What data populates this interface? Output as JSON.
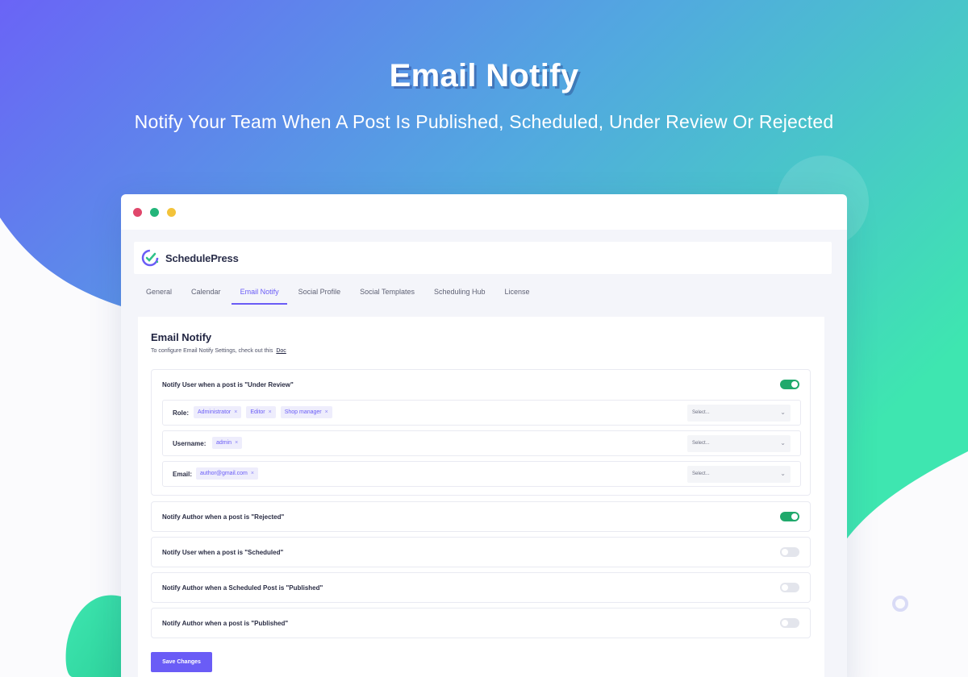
{
  "hero": {
    "title": "Email Notify",
    "subtitle": "Notify Your Team When A Post Is Published, Scheduled, Under Review Or Rejected"
  },
  "colors": {
    "gradient_start": "#6a64f6",
    "gradient_end": "#3ee6b0",
    "accent": "#6a5cf6",
    "toggle_on": "#20a96c",
    "toggle_off": "#e3e5ec",
    "dot_red": "#e0476b",
    "dot_green": "#23b57a",
    "dot_yellow": "#f3c33a"
  },
  "app": {
    "name": "SchedulePress",
    "logo_icon": "schedulepress-clock-check-icon"
  },
  "tabs": [
    {
      "label": "General",
      "active": false
    },
    {
      "label": "Calendar",
      "active": false
    },
    {
      "label": "Email Notify",
      "active": true
    },
    {
      "label": "Social Profile",
      "active": false
    },
    {
      "label": "Social Templates",
      "active": false
    },
    {
      "label": "Scheduling Hub",
      "active": false
    },
    {
      "label": "License",
      "active": false
    }
  ],
  "panel": {
    "title": "Email Notify",
    "description": "To configure Email Notify Settings, check out this",
    "doc_link": "Doc"
  },
  "settings": {
    "under_review": {
      "label": "Notify User when a post is \"Under Review\"",
      "enabled": true,
      "role": {
        "label": "Role:",
        "chips": [
          "Administrator",
          "Editor",
          "Shop manager"
        ],
        "placeholder": "Select..."
      },
      "username": {
        "label": "Username:",
        "chips": [
          "admin"
        ],
        "placeholder": "Select..."
      },
      "email": {
        "label": "Email:",
        "chips": [
          "author@gmail.com"
        ],
        "placeholder": "Select..."
      }
    },
    "rejected": {
      "label": "Notify Author when a post is \"Rejected\"",
      "enabled": true
    },
    "scheduled": {
      "label": "Notify User when a post is \"Scheduled\"",
      "enabled": false
    },
    "scheduled_published": {
      "label": "Notify Author when a Scheduled Post is \"Published\"",
      "enabled": false
    },
    "published": {
      "label": "Notify Author when a post is \"Published\"",
      "enabled": false
    }
  },
  "chip_remove_symbol": "×",
  "save_label": "Save Changes"
}
